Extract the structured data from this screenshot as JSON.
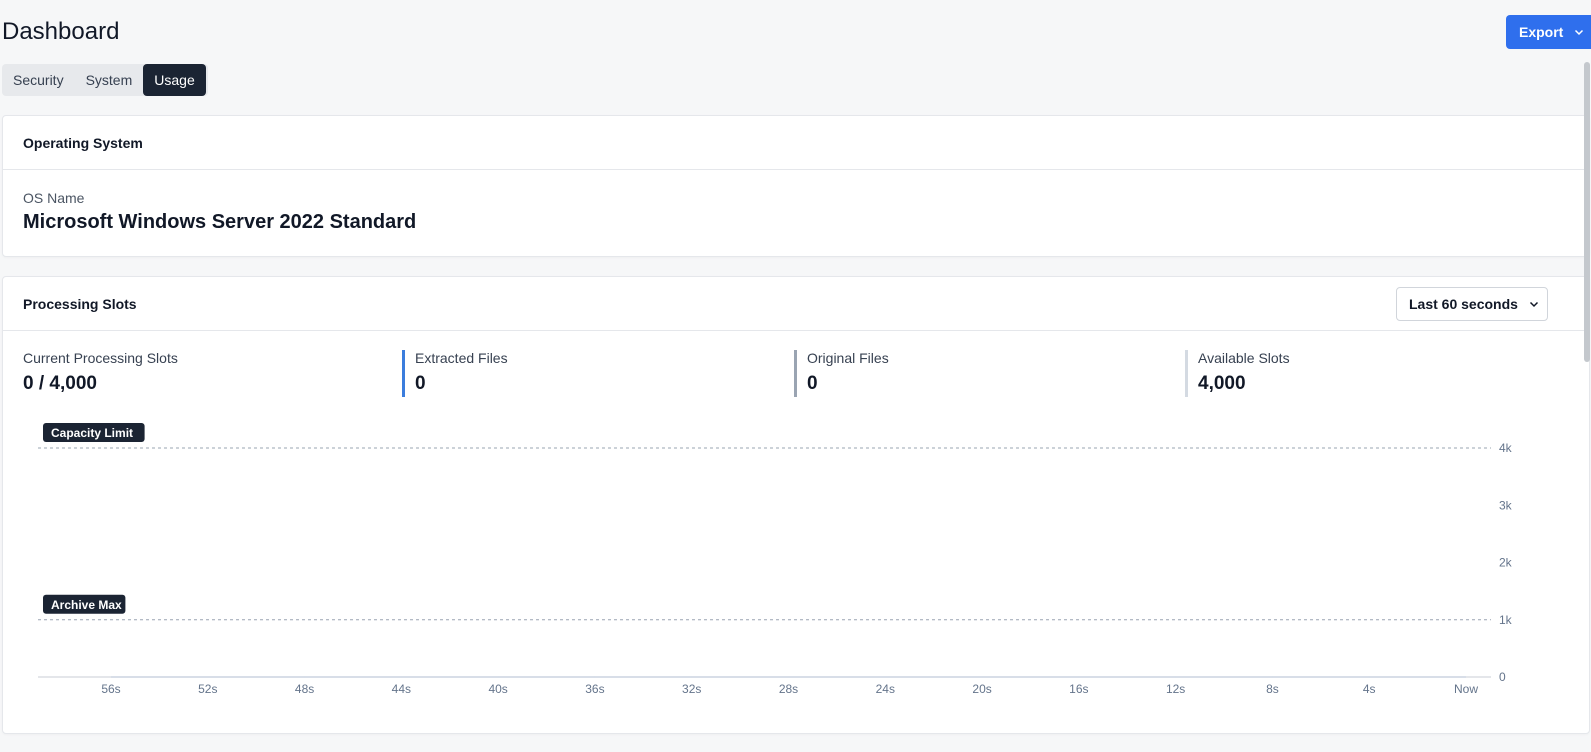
{
  "page": {
    "title": "Dashboard"
  },
  "toolbar": {
    "export_label": "Export"
  },
  "tabs": [
    {
      "label": "Security",
      "active": false
    },
    {
      "label": "System",
      "active": false
    },
    {
      "label": "Usage",
      "active": true
    }
  ],
  "os_card": {
    "title": "Operating System",
    "os_name_label": "OS Name",
    "os_name_value": "Microsoft Windows Server 2022 Standard"
  },
  "slots_card": {
    "title": "Processing Slots",
    "range_select": {
      "selected": "Last 60 seconds"
    },
    "stats": [
      {
        "label": "Current Processing Slots",
        "value": "0 / 4,000"
      },
      {
        "label": "Extracted Files",
        "value": "0",
        "color": "#3b7ddd"
      },
      {
        "label": "Original Files",
        "value": "0",
        "color": "#9aa4b2"
      },
      {
        "label": "Available Slots",
        "value": "4,000",
        "color": "#d4dae2"
      }
    ]
  },
  "colors": {
    "accent": "#2f6fed",
    "tab_active_bg": "#1b2433",
    "reference_label_bg": "#1b2433",
    "reference_line": "#9aa4b2"
  },
  "chart_data": {
    "type": "area",
    "x": [
      "56s",
      "52s",
      "48s",
      "44s",
      "40s",
      "36s",
      "32s",
      "28s",
      "24s",
      "20s",
      "16s",
      "12s",
      "8s",
      "4s",
      "Now"
    ],
    "series": [
      {
        "values": [
          0,
          0,
          0,
          0,
          0,
          0,
          0,
          0,
          0,
          0,
          0,
          0,
          0,
          0,
          0
        ]
      },
      {
        "values": [
          0,
          0,
          0,
          0,
          0,
          0,
          0,
          0,
          0,
          0,
          0,
          0,
          0,
          0,
          0
        ]
      }
    ],
    "ylim": [
      0,
      4000
    ],
    "y_ticks": [
      {
        "value": 0,
        "label": "0"
      },
      {
        "value": 1000,
        "label": "1k"
      },
      {
        "value": 2000,
        "label": "2k"
      },
      {
        "value": 3000,
        "label": "3k"
      },
      {
        "value": 4000,
        "label": "4k"
      }
    ],
    "reference_lines": [
      {
        "label": "Capacity Limit",
        "value": 4000
      },
      {
        "label": "Archive Max",
        "value": 1000
      }
    ],
    "y_axis_side": "right",
    "grid": false
  }
}
